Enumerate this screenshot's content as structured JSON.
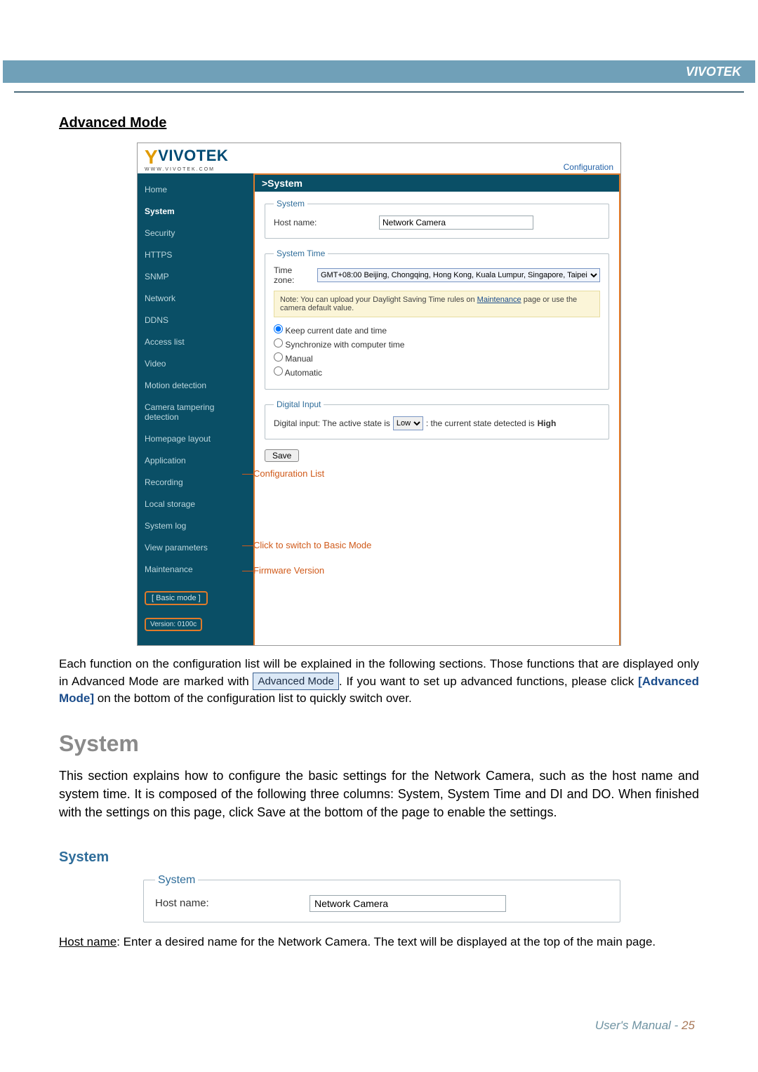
{
  "header": {
    "brand": "VIVOTEK"
  },
  "section_title": "Advanced Mode",
  "screenshot": {
    "logo_text": "VIVOTEK",
    "logo_sub": "WWW.VIVOTEK.COM",
    "config_link": "Configuration",
    "breadcrumb": ">System",
    "sidebar": {
      "items": [
        "Home",
        "System",
        "Security",
        "HTTPS",
        "SNMP",
        "Network",
        "DDNS",
        "Access list",
        "Video",
        "Motion detection",
        "Camera tampering detection",
        "Homepage layout",
        "Application",
        "Recording",
        "Local storage",
        "System log",
        "View parameters",
        "Maintenance"
      ],
      "basic_mode": "[ Basic mode ]",
      "version": "Version: 0100c"
    },
    "panels": {
      "system": {
        "legend": "System",
        "host_label": "Host name:",
        "host_value": "Network Camera"
      },
      "time": {
        "legend": "System Time",
        "tz_label": "Time zone:",
        "tz_value": "GMT+08:00 Beijing, Chongqing, Hong Kong, Kuala Lumpur, Singapore, Taipei",
        "note_prefix": "Note: You can upload your Daylight Saving Time rules on ",
        "note_link": "Maintenance",
        "note_suffix": " page or use the camera default value.",
        "radios": [
          "Keep current date and time",
          "Synchronize with computer time",
          "Manual",
          "Automatic"
        ]
      },
      "di": {
        "legend": "Digital Input",
        "prefix": "Digital input: The active state is",
        "select": "Low",
        "mid": ": the current state detected is",
        "state": "High"
      },
      "save": "Save"
    },
    "callouts": {
      "config_list": "Configuration List",
      "basic": "Click to switch to Basic Mode",
      "version": "Firmware Version"
    }
  },
  "body_text": {
    "p1a": "Each function on the configuration list will be explained in the following sections. Those functions that are displayed only in Advanced Mode are marked with ",
    "badge": "Advanced Mode",
    "p1b": ". If you want to set up advanced functions, please click ",
    "p1c": "[Advanced Mode]",
    "p1d": " on the bottom of the configuration list to quickly switch over.",
    "h_system": "System",
    "p2": "This section explains how to configure the basic settings for the Network Camera, such as the host name and system time. It is composed of the following three columns: System, System Time and DI and DO. When finished with the settings on this page, click Save at the bottom of the page to enable the settings.",
    "sub": "System",
    "fs2": {
      "legend": "System",
      "label": "Host name:",
      "value": "Network Camera"
    },
    "hostline_u": "Host name",
    "hostline": ": Enter a desired name for the Network Camera. The text will be displayed at the top of the main page."
  },
  "footer": {
    "label": "User's Manual - ",
    "page": "25"
  }
}
